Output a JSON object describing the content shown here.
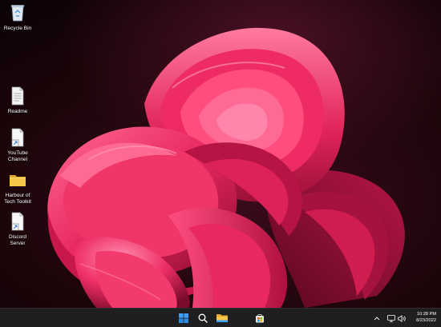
{
  "desktop": {
    "icons": [
      {
        "label": "Recycle Bin",
        "icon": "recycle-bin-icon"
      },
      {
        "label": "Readme",
        "icon": "text-document-icon"
      },
      {
        "label": "YouTube\nChannel",
        "icon": "shortcut-file-icon"
      },
      {
        "label": "Harbour of\nTech Toolkit",
        "icon": "folder-icon"
      },
      {
        "label": "Discord\nServer",
        "icon": "shortcut-file-icon"
      }
    ]
  },
  "taskbar": {
    "apps": [
      {
        "name": "Start",
        "icon": "windows-start-icon"
      },
      {
        "name": "Search",
        "icon": "search-icon"
      },
      {
        "name": "File Explorer",
        "icon": "file-explorer-icon"
      },
      {
        "name": "Microsoft Store",
        "icon": "store-icon"
      }
    ],
    "tray": {
      "icons": [
        "chevron-up-icon",
        "network-icon",
        "volume-icon"
      ]
    },
    "clock": {
      "time": "10:28 PM",
      "date": "8/23/2022"
    }
  },
  "colors": {
    "bloom_primary": "#e8275f",
    "bloom_light": "#ff5a8a",
    "bloom_dark": "#7a0a2a",
    "background": "#1a0509",
    "taskbar": "#1f1f22",
    "folder": "#f5c64a",
    "accent": "#3aa0ff"
  }
}
